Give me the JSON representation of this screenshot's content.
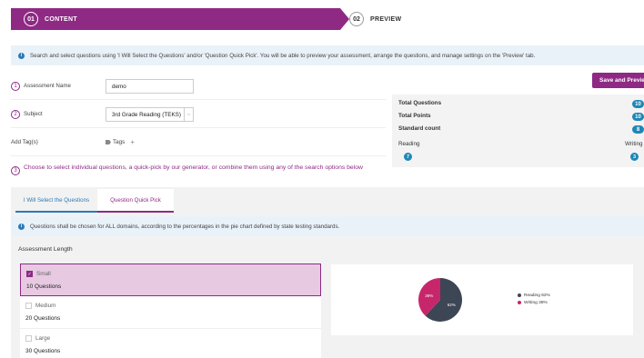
{
  "steps": [
    {
      "num": "01",
      "label": "CONTENT"
    },
    {
      "num": "02",
      "label": "PREVIEW"
    }
  ],
  "info_text": "Search and select questions using 'I Will Select the Questions' and/or 'Question Quick Pick'. You will be able to preview your assessment, arrange the questions, and manage settings on the 'Preview' tab.",
  "save_button": "Save and Preview",
  "form": {
    "name_num": "1",
    "name_label": "Assessment Name",
    "name_value": "demo",
    "subject_num": "2",
    "subject_label": "Subject",
    "subject_value": "3rd Grade Reading (TEKS)",
    "tags_label": "Add Tag(s)",
    "tags_button": "Tags",
    "tags_plus": "+"
  },
  "choose": {
    "num": "3",
    "text": "Choose to select individual questions, a quick-pick by our generator, or combine them using any of the search options below"
  },
  "stats": {
    "total_questions_label": "Total Questions",
    "total_questions": "10",
    "total_points_label": "Total Points",
    "total_points": "10",
    "standard_count_label": "Standard count",
    "standard_count": "8",
    "reading_label": "Reading",
    "reading": "7",
    "writing_label": "Writing",
    "writing": "3"
  },
  "tabs": [
    "I Will Select the Questions",
    "Question Quick Pick"
  ],
  "quick_pick_info": "Questions shall be chosen for ALL domains, according to the percentages in the pie chart defined by state testing standards.",
  "length_title": "Assessment Length",
  "length_options": [
    {
      "label": "Small",
      "count": "10 Questions",
      "selected": true
    },
    {
      "label": "Medium",
      "count": "20 Questions",
      "selected": false
    },
    {
      "label": "Large",
      "count": "30 Questions",
      "selected": false
    }
  ],
  "icons": {
    "info": "info-icon",
    "tag": "tag-icon",
    "select_arrow": "chevron-down-icon",
    "check": "check-icon"
  },
  "colors": {
    "brand": "#8e2a84",
    "badge": "#1f87b5",
    "reading": "#3d4654",
    "writing": "#c8266b"
  },
  "chart_data": {
    "type": "pie",
    "slices": [
      {
        "name": "Reading",
        "value": 62,
        "color": "#3d4654",
        "label": "62%",
        "legend": "Reading 62%"
      },
      {
        "name": "Writing",
        "value": 38,
        "color": "#c8266b",
        "label": "38%",
        "legend": "Writing 38%"
      }
    ],
    "legend_position": "right"
  }
}
